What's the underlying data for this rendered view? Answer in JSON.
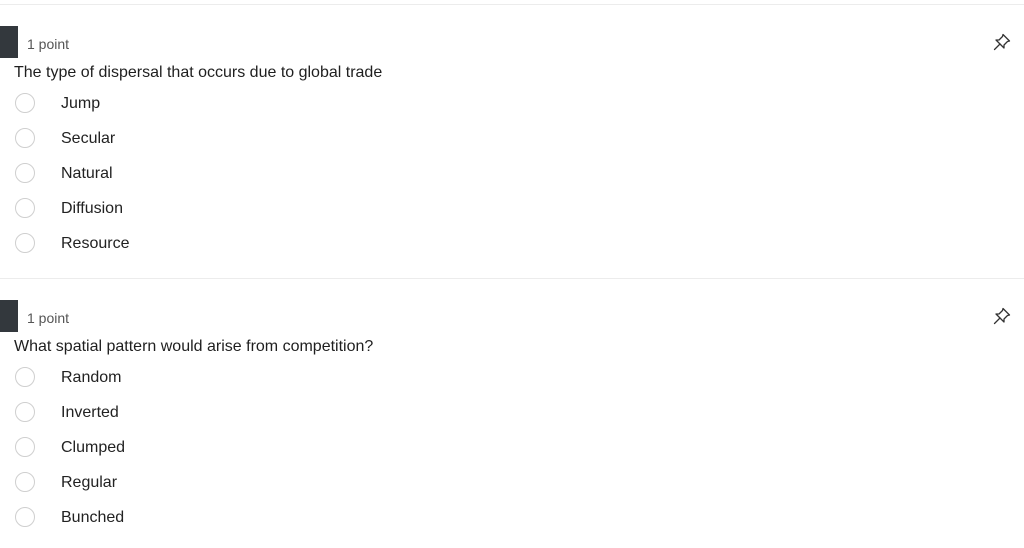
{
  "questions": [
    {
      "points": "1 point",
      "prompt": "The type of dispersal that occurs due to global trade",
      "options": [
        "Jump",
        "Secular",
        "Natural",
        "Diffusion",
        "Resource"
      ]
    },
    {
      "points": "1 point",
      "prompt": "What spatial pattern would arise from competition?",
      "options": [
        "Random",
        "Inverted",
        "Clumped",
        "Regular",
        "Bunched"
      ]
    }
  ],
  "icons": {
    "pin": "pushpin-icon"
  },
  "colors": {
    "marker": "#33383d",
    "radio_border": "#cfcfcf",
    "text": "#1f1f1f"
  }
}
